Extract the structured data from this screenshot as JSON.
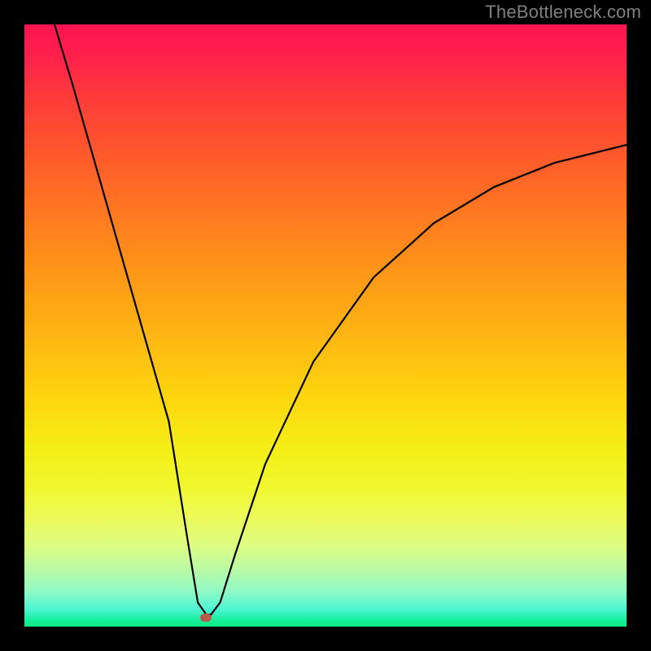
{
  "watermark": "TheBottleneck.com",
  "marker_color": "#b85c4f",
  "curve_color": "#000000",
  "chart_data": {
    "type": "line",
    "title": "",
    "xlabel": "",
    "ylabel": "",
    "xlim": [
      0,
      100
    ],
    "ylim": [
      0,
      100
    ],
    "series": [
      {
        "name": "bottleneck-curve",
        "x": [
          5,
          8,
          12,
          16,
          20,
          24,
          27,
          28.8,
          30.2,
          31,
          32.5,
          35,
          40,
          48,
          58,
          68,
          78,
          88,
          100
        ],
        "values": [
          100,
          90,
          76,
          62,
          48,
          34,
          15,
          4,
          2,
          2,
          4,
          12,
          27,
          44,
          58,
          67,
          73,
          77,
          80
        ]
      }
    ],
    "annotations": [
      {
        "name": "min-marker",
        "x": 30.2,
        "y": 1.5
      }
    ],
    "gradient_stops": [
      {
        "pct": 0,
        "color": "#ff1452"
      },
      {
        "pct": 50,
        "color": "#fec010"
      },
      {
        "pct": 80,
        "color": "#eefb48"
      },
      {
        "pct": 100,
        "color": "#07ed7f"
      }
    ]
  }
}
